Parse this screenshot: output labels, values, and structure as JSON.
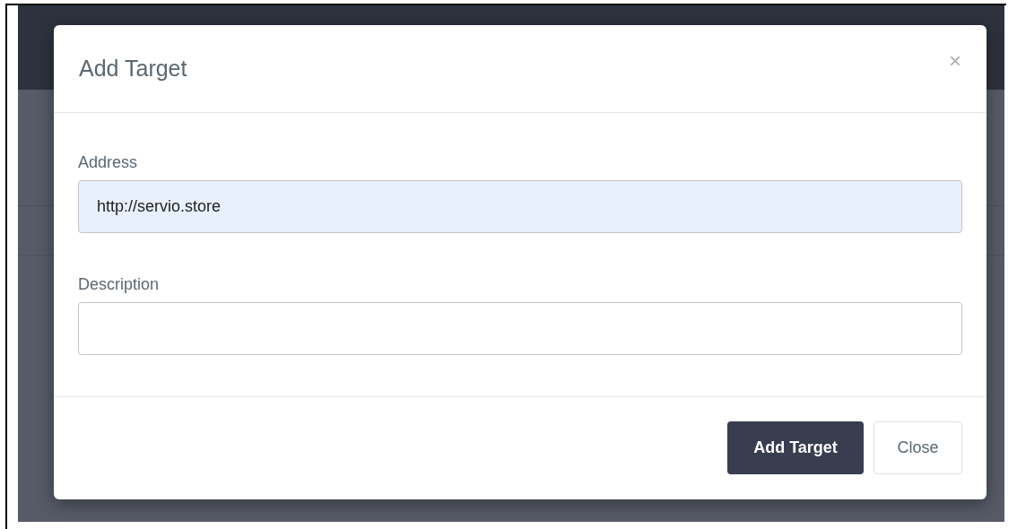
{
  "dialog": {
    "title": "Add Target",
    "close_icon": "×",
    "fields": [
      {
        "label": "Address",
        "value": "http://servio.store",
        "autofilled": true
      },
      {
        "label": "Description",
        "autofilled": false
      }
    ],
    "buttons": [
      {
        "label": "Add Target",
        "kind": "primary"
      },
      {
        "label": "Close",
        "kind": "secondary"
      }
    ]
  }
}
